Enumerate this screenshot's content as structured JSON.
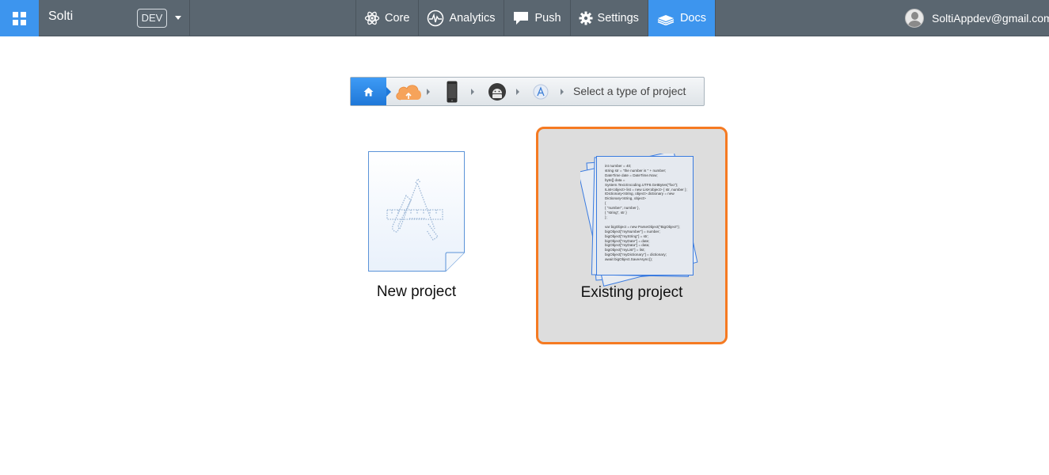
{
  "app": {
    "name": "Solti",
    "env": "DEV"
  },
  "nav": {
    "items": [
      {
        "label": "Core",
        "icon": "atom-icon"
      },
      {
        "label": "Analytics",
        "icon": "pulse-icon"
      },
      {
        "label": "Push",
        "icon": "chat-bubble-icon"
      },
      {
        "label": "Settings",
        "icon": "gear-icon"
      },
      {
        "label": "Docs",
        "icon": "books-icon",
        "active": true
      }
    ]
  },
  "user": {
    "email": "SoltiAppdev@gmail.com"
  },
  "breadcrumb": {
    "steps": [
      "home-icon",
      "cloud-upload-icon",
      "phone-icon",
      "android-icon",
      "app-store-icon"
    ],
    "current_label": "Select a type of project"
  },
  "options": {
    "new_project": "New project",
    "existing_project": "Existing project"
  },
  "code_sample": [
    "int number = 40;",
    "string str = \"the number is \" + number;",
    "DateTime date = DateTime.Now;",
    "byte[] data =",
    "System.Text.Encoding.UTF8.GetBytes(\"foo\");",
    "IList<object> list = new List<object> { str, number };",
    "IDictionary<string, object> dictionary = new",
    "Dictionary<string, object>",
    "{",
    "  { \"number\", number },",
    "  { \"string\", str }",
    "};",
    "",
    "var bigObject = new ParseObject(\"BigObject\");",
    "bigObject[\"myNumber\"] = number;",
    "bigObject[\"myString\"] = str;",
    "bigObject[\"myDate\"] = date;",
    "bigObject[\"myData\"] = data;",
    "bigObject[\"myList\"] = list;",
    "bigObject[\"myDictionary\"] = dictionary;",
    "await bigObject.SaveAsync();"
  ],
  "colors": {
    "topbar": "#5a6670",
    "accent": "#3d95ee",
    "selected_border": "#f57a22",
    "selected_bg": "#dddddd"
  }
}
